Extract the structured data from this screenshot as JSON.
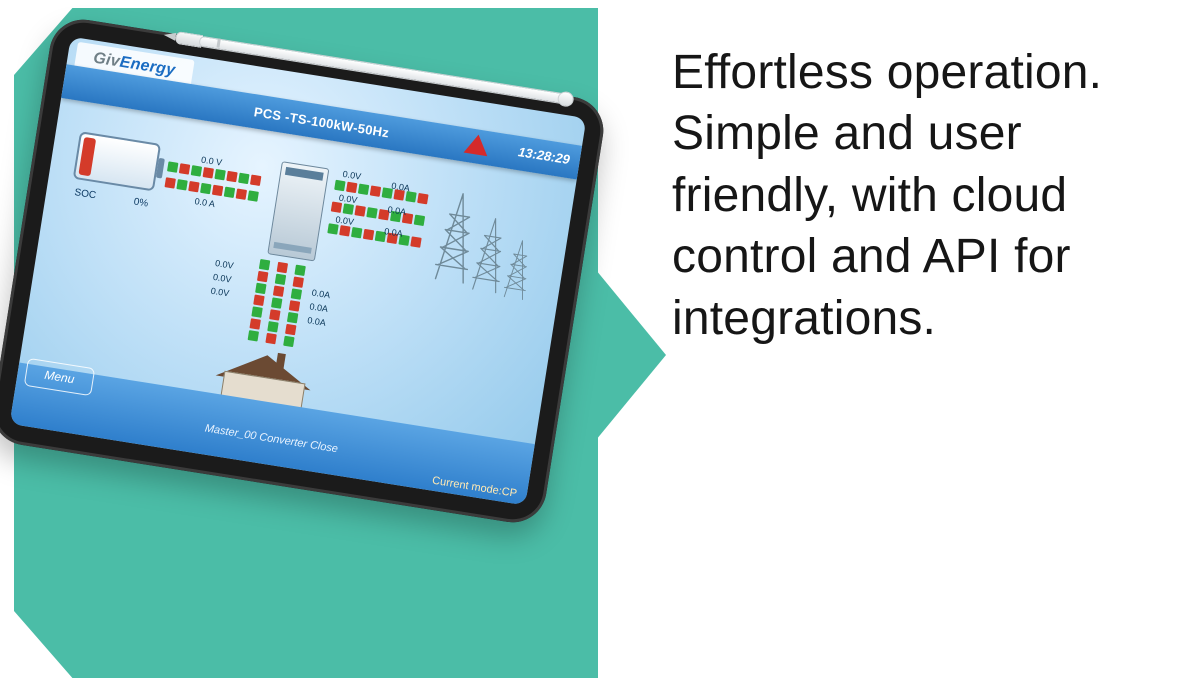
{
  "marketing": {
    "text": "Effortless operation. Simple and user friendly, with cloud control and API for integrations."
  },
  "tablet": {
    "brand_a": "Giv",
    "brand_b": "Energy",
    "title": "PCS -TS-100kW-50Hz",
    "time": "13:28:29",
    "menu_label": "Menu",
    "status": "Master_00 Converter Close",
    "current_mode": "Current mode:CP",
    "battery": {
      "soc_label": "SOC",
      "pct": "0%"
    },
    "readings": {
      "batt_v": "0.0 V",
      "batt_a": "0.0 A",
      "grid_v1": "0.0V",
      "grid_a1": "0.0A",
      "grid_v2": "0.0V",
      "grid_a2": "0.0A",
      "grid_v3": "0.0V",
      "grid_a3": "0.0A",
      "load_v1": "0.0V",
      "load_a1": "0.0A",
      "load_v2": "0.0V",
      "load_a2": "0.0A",
      "load_v3": "0.0V",
      "load_a3": "0.0A"
    }
  },
  "icons": {
    "alert": "alert-triangle",
    "battery": "battery",
    "cabinet": "pcs-cabinet",
    "house": "house",
    "pylon": "transmission-tower",
    "stylus": "stylus"
  },
  "colors": {
    "teal": "#4bbda7",
    "led_green": "#2fae3f",
    "led_red": "#d43b2a",
    "header_blue": "#2a77c2"
  }
}
